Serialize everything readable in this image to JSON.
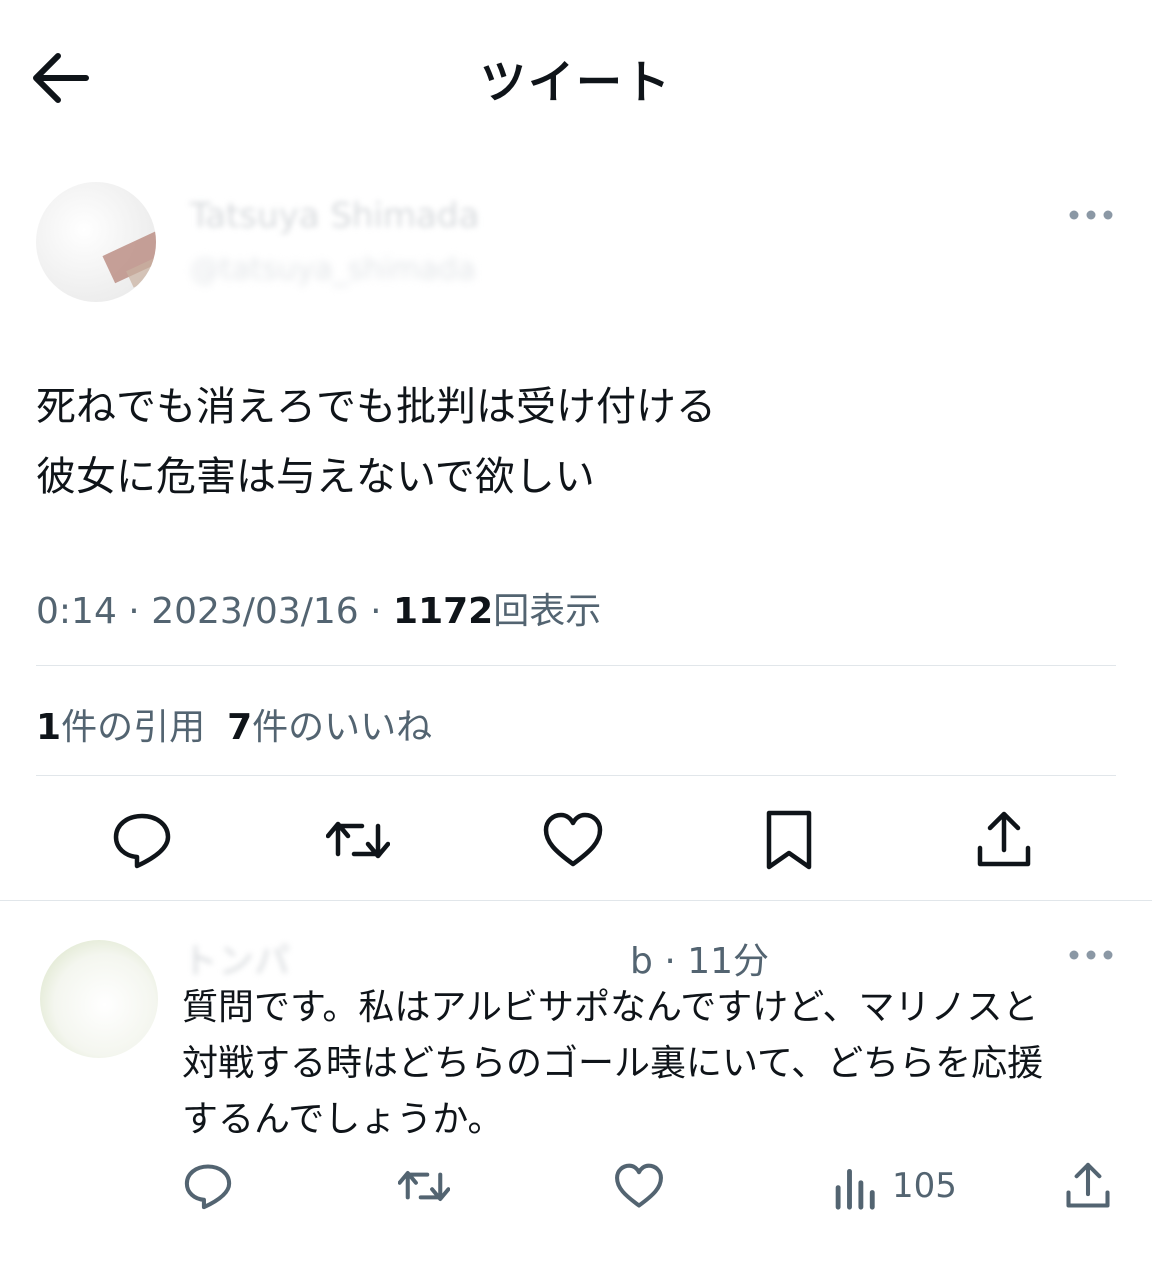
{
  "header": {
    "title": "ツイート"
  },
  "tweet": {
    "author_name": "Tatsuya Shimada",
    "author_handle": "@tatsuya_shimada",
    "text_lines": [
      "死ねでも消えろでも批判は受け付ける",
      "彼女に危害は与えないで欲しい"
    ],
    "time": "0:14",
    "date": "2023/03/16",
    "views": "1172",
    "views_label": "回表示",
    "quotes_count": "1",
    "quotes_label": "件の引用",
    "likes_count": "7",
    "likes_label": "件のいいね"
  },
  "reply": {
    "author_blurred": "トンパ",
    "handle_fragment": "b",
    "time": "11分",
    "text_lines": [
      "質問です。私はアルビサポなんですけど、マリノスと",
      "対戦する時はどちらのゴール裏にいて、どちらを応援",
      "するんでしょうか。"
    ],
    "views": "105"
  },
  "icons": {
    "back": "arrow-left-icon",
    "more": "more-horizontal-icon",
    "reply": "reply-icon",
    "retweet": "retweet-icon",
    "like": "heart-icon",
    "bookmark": "bookmark-icon",
    "share": "share-icon",
    "views": "analytics-icon"
  },
  "colors": {
    "text": "#0f1419",
    "secondary": "#536471",
    "divider": "#e1e6ea"
  }
}
